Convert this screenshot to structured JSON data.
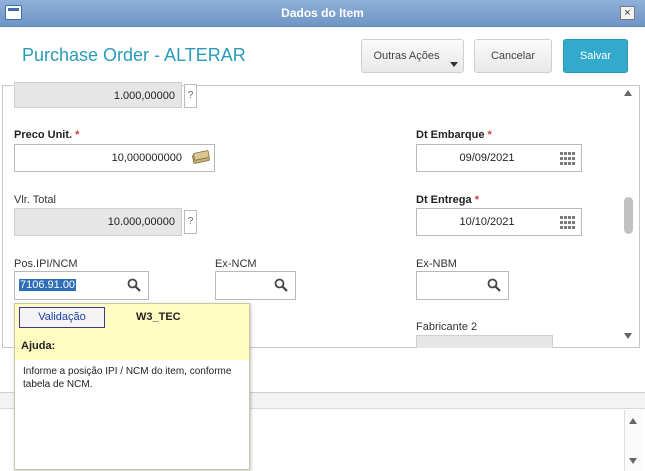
{
  "window": {
    "title": "Dados do Item",
    "close": "×"
  },
  "header": {
    "title": "Purchase Order - ALTERAR",
    "outras_acoes": "Outras Ações",
    "cancelar": "Cancelar",
    "salvar": "Salvar"
  },
  "form": {
    "quantidade_value": "1.000,00000",
    "preco_unit_label": "Preco Unit.",
    "preco_unit_value": "10,000000000",
    "dt_embarque_label": "Dt Embarque",
    "dt_embarque_value": "09/09/2021",
    "vlr_total_label": "Vlr. Total",
    "vlr_total_value": "10.000,00000",
    "dt_entrega_label": "Dt Entrega",
    "dt_entrega_value": "10/10/2021",
    "pos_ipi_label": "Pos.IPI/NCM",
    "pos_ipi_value": "7106.91.00",
    "ex_ncm_label": "Ex-NCM",
    "ex_nbm_label": "Ex-NBM",
    "fabricante2_label": "Fabricante 2",
    "help_glyph": "?",
    "required_mark": "*"
  },
  "tooltip": {
    "validacao": "Validação",
    "code": "W3_TEC",
    "ajuda_label": "Ajuda:",
    "help_text": "Informe a posição IPI / NCM do item, conforme tabela de NCM."
  },
  "icons": {
    "search": "search-icon",
    "calendar": "calendar-icon",
    "money": "money-icon",
    "help": "help-icon"
  },
  "colors": {
    "title_accent": "#2a9bb8",
    "primary_button": "#33a9cc",
    "titlebar": "#7aa0cf",
    "tooltip_bg": "#fffcc2",
    "required": "#d43b3b",
    "selection": "#2f6fb7"
  }
}
